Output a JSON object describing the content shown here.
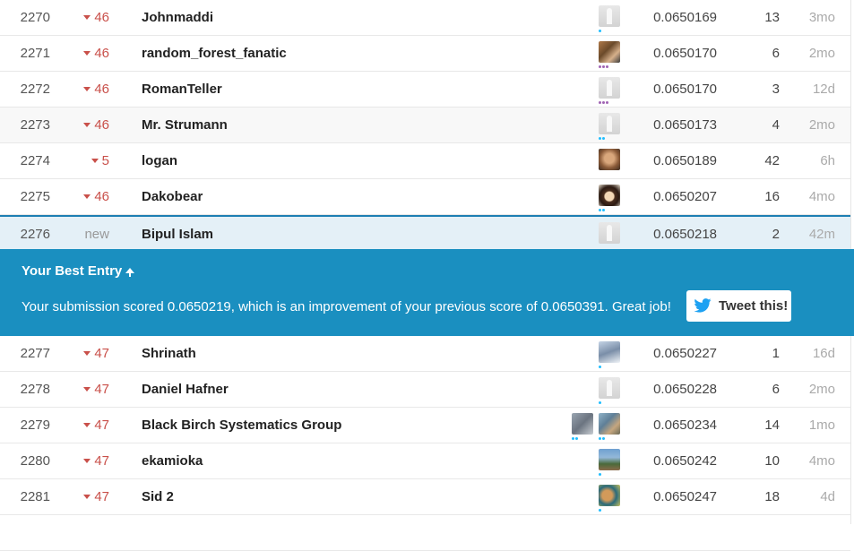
{
  "rows_top": [
    {
      "rank": "2270",
      "delta": "46",
      "team": "Johnmaddi",
      "avatars": [
        "default"
      ],
      "tier": "teal",
      "tier_n": 1,
      "score": "0.0650169",
      "entries": "13",
      "last": "3mo"
    },
    {
      "rank": "2271",
      "delta": "46",
      "team": "random_forest_fanatic",
      "avatars": [
        "photo1"
      ],
      "tier": "purple",
      "tier_n": 3,
      "score": "0.0650170",
      "entries": "6",
      "last": "2mo"
    },
    {
      "rank": "2272",
      "delta": "46",
      "team": "RomanTeller",
      "avatars": [
        "default"
      ],
      "tier": "purple",
      "tier_n": 3,
      "score": "0.0650170",
      "entries": "3",
      "last": "12d"
    },
    {
      "rank": "2273",
      "delta": "46",
      "team": "Mr. Strumann",
      "avatars": [
        "default"
      ],
      "tier": "teal",
      "tier_n": 2,
      "score": "0.0650173",
      "entries": "4",
      "last": "2mo"
    },
    {
      "rank": "2274",
      "delta": "5",
      "team": "logan",
      "avatars": [
        "photo2"
      ],
      "tier": "",
      "tier_n": 0,
      "score": "0.0650189",
      "entries": "42",
      "last": "6h"
    },
    {
      "rank": "2275",
      "delta": "46",
      "team": "Dakobear",
      "avatars": [
        "photo3"
      ],
      "tier": "teal",
      "tier_n": 2,
      "score": "0.0650207",
      "entries": "16",
      "last": "4mo"
    }
  ],
  "my_row": {
    "rank": "2276",
    "delta": "new",
    "team": "Bipul Islam",
    "score": "0.0650218",
    "entries": "2",
    "last": "42m"
  },
  "banner": {
    "title": "Your Best Entry",
    "message": "Your submission scored 0.0650219, which is an improvement of your previous score of 0.0650391. Great job!",
    "tweet_label": "Tweet this!"
  },
  "rows_bottom": [
    {
      "rank": "2277",
      "delta": "47",
      "team": "Shrinath",
      "avatars": [
        "photo4"
      ],
      "tier": "teal",
      "tier_n": 1,
      "score": "0.0650227",
      "entries": "1",
      "last": "16d"
    },
    {
      "rank": "2278",
      "delta": "47",
      "team": "Daniel Hafner",
      "avatars": [
        "default"
      ],
      "tier": "teal",
      "tier_n": 1,
      "score": "0.0650228",
      "entries": "6",
      "last": "2mo"
    },
    {
      "rank": "2279",
      "delta": "47",
      "team": "Black Birch Systematics Group",
      "avatars": [
        "photo5",
        "photo6"
      ],
      "tier": "teal",
      "tier_n": 2,
      "score": "0.0650234",
      "entries": "14",
      "last": "1mo"
    },
    {
      "rank": "2280",
      "delta": "47",
      "team": "ekamioka",
      "avatars": [
        "photo7"
      ],
      "tier": "teal",
      "tier_n": 1,
      "score": "0.0650242",
      "entries": "10",
      "last": "4mo"
    },
    {
      "rank": "2281",
      "delta": "47",
      "team": "Sid 2",
      "avatars": [
        "photo8"
      ],
      "tier": "teal",
      "tier_n": 1,
      "score": "0.0650247",
      "entries": "18",
      "last": "4d"
    }
  ],
  "colors": {
    "accent": "#1a8fc0",
    "down": "#c9504a",
    "tier_teal": "#20beff",
    "tier_purple": "#a064b4"
  }
}
